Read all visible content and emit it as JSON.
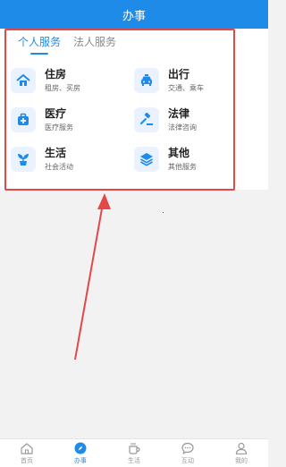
{
  "header": {
    "title": "办事"
  },
  "tabs": [
    {
      "label": "个人服务",
      "active": true
    },
    {
      "label": "法人服务",
      "active": false
    }
  ],
  "services": [
    {
      "title": "住房",
      "subtitle": "租房、买房",
      "icon": "house-icon"
    },
    {
      "title": "出行",
      "subtitle": "交通、乘车",
      "icon": "car-icon"
    },
    {
      "title": "医疗",
      "subtitle": "医疗服务",
      "icon": "medical-kit-icon"
    },
    {
      "title": "法律",
      "subtitle": "法律咨询",
      "icon": "gavel-icon"
    },
    {
      "title": "生活",
      "subtitle": "社会活动",
      "icon": "plant-icon"
    },
    {
      "title": "其他",
      "subtitle": "其他服务",
      "icon": "layers-icon"
    }
  ],
  "bottom_nav": [
    {
      "label": "首页",
      "icon": "home-icon",
      "active": false
    },
    {
      "label": "办事",
      "icon": "compass-icon",
      "active": true
    },
    {
      "label": "生活",
      "icon": "coffee-cup-icon",
      "active": false
    },
    {
      "label": "互动",
      "icon": "chat-bubble-icon",
      "active": false
    },
    {
      "label": "我的",
      "icon": "user-icon",
      "active": false
    }
  ],
  "colors": {
    "primary": "#1f8be8",
    "annotation": "#e24848",
    "icon_bg": "#e9f2fe"
  }
}
